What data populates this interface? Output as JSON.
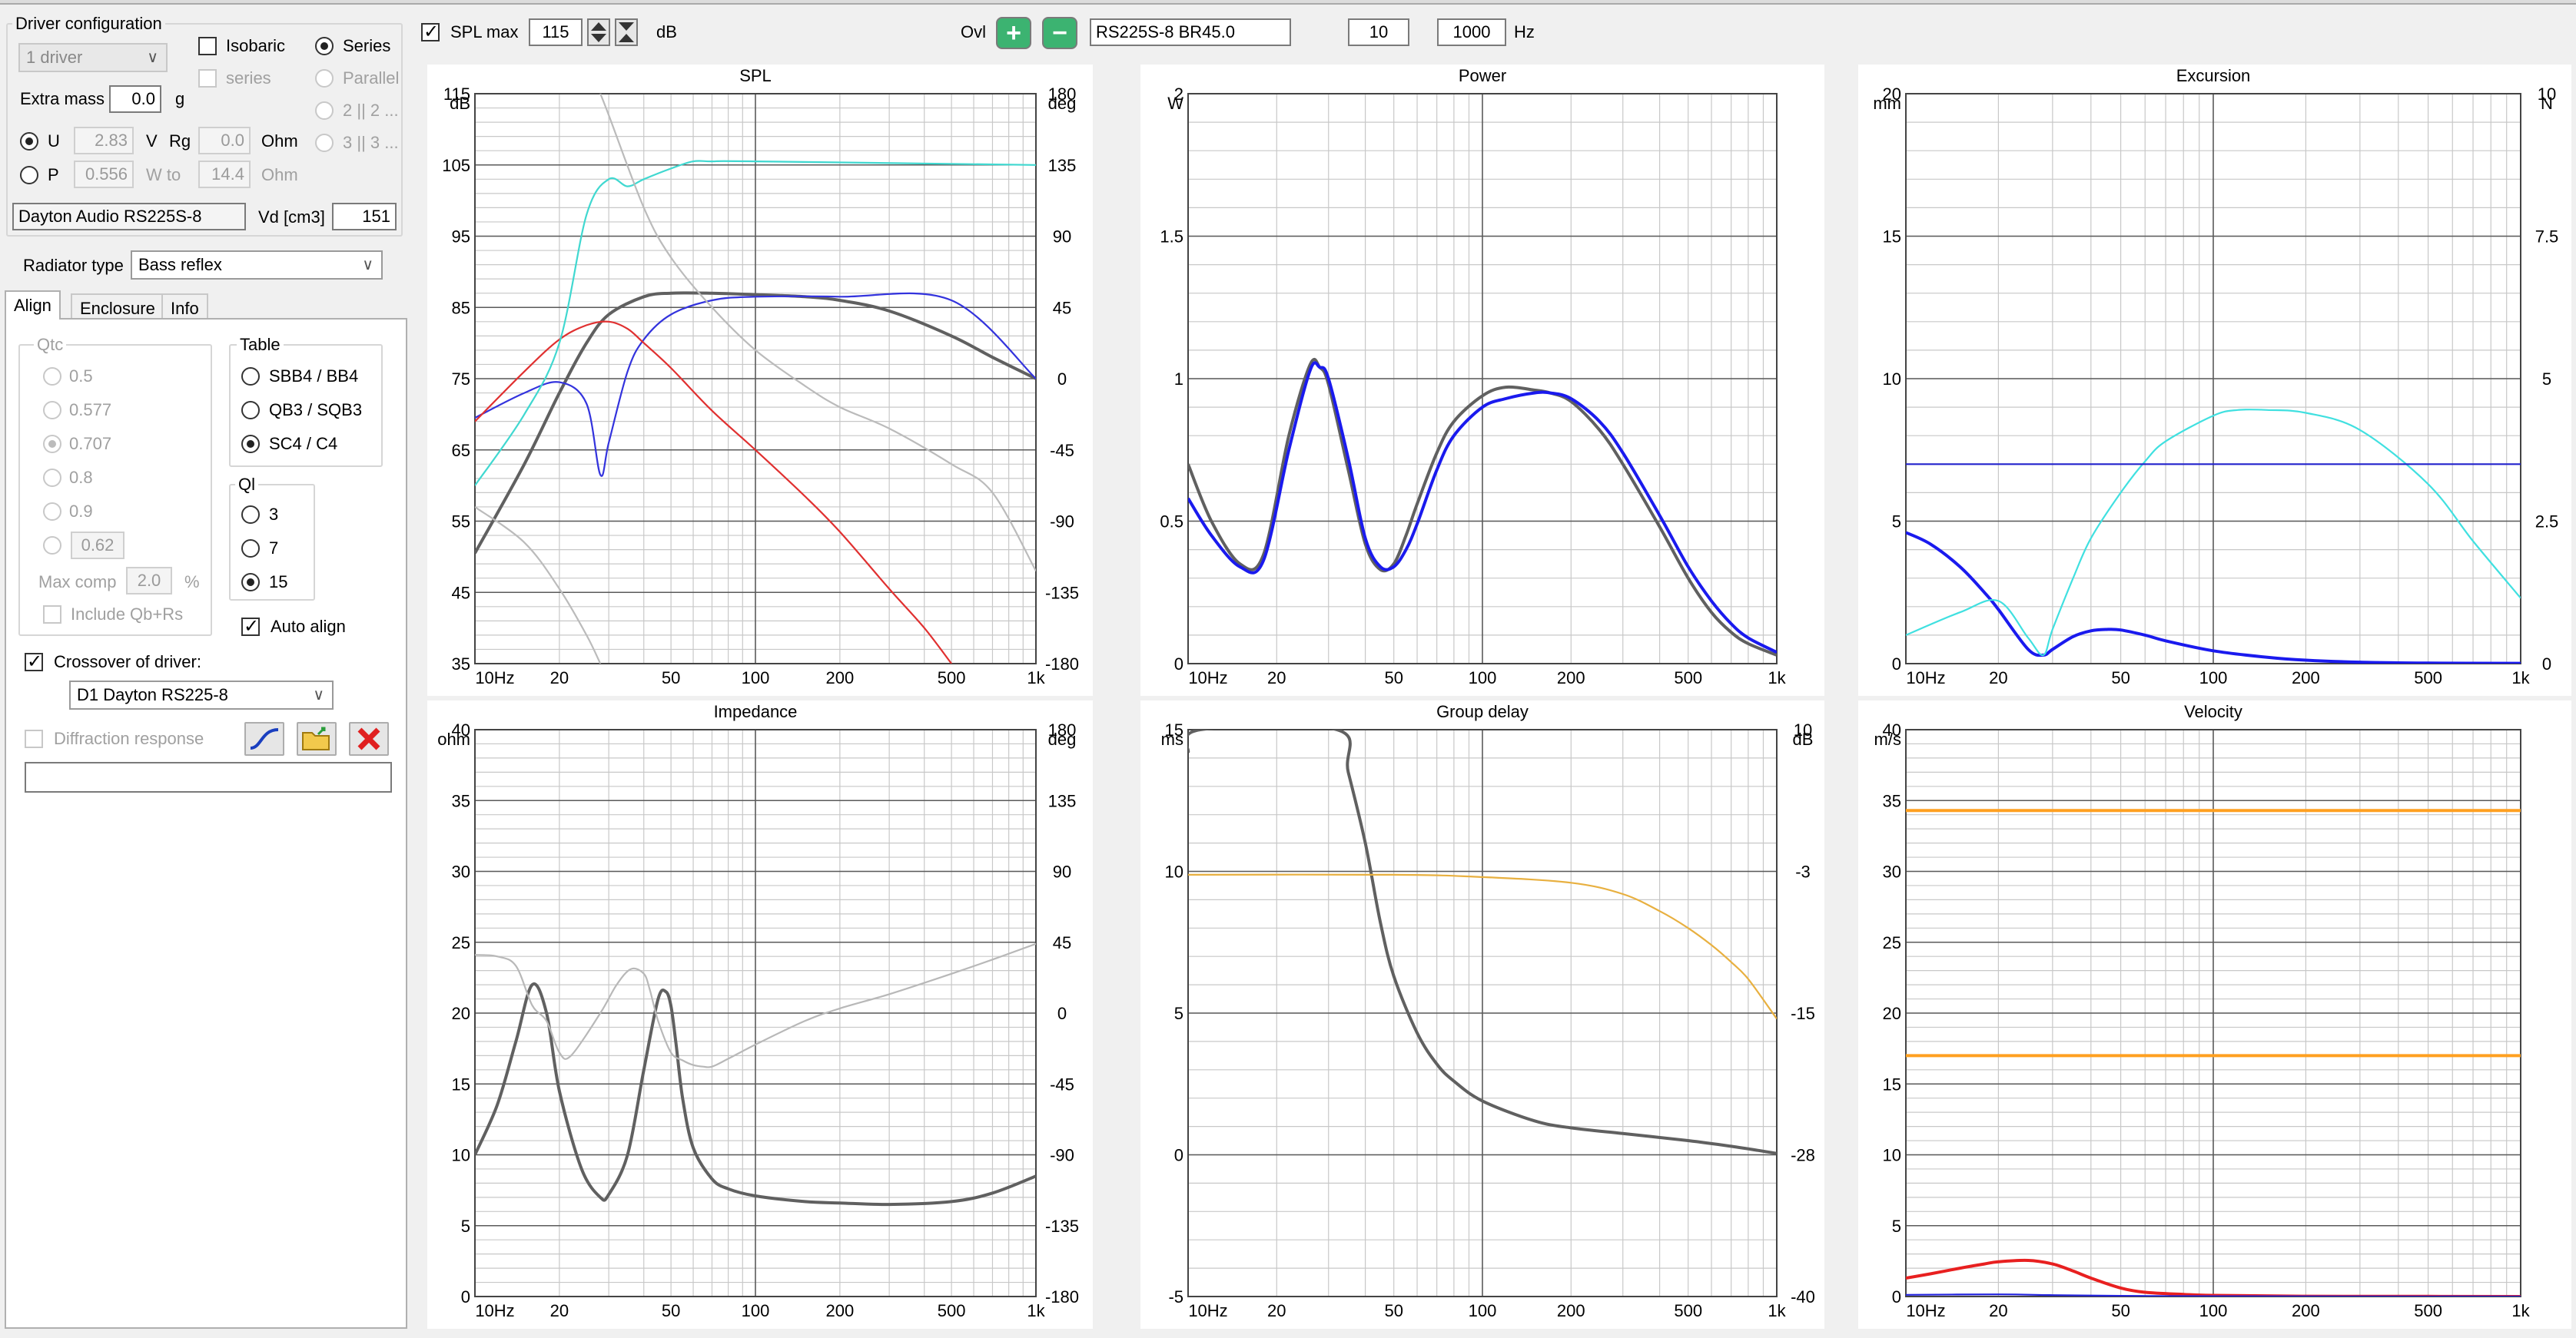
{
  "left": {
    "driver_config": {
      "title": "Driver configuration",
      "count_select": "1 driver",
      "isobaric": "Isobaric",
      "series": "Series",
      "series_sub": "series",
      "parallel": "Parallel",
      "opt_22": "2 || 2 ...",
      "opt_33": "3 || 3 ...",
      "extra_mass_label": "Extra mass",
      "extra_mass_value": "0.0",
      "extra_mass_unit": "g",
      "u_label": "U",
      "u_value": "2.83",
      "u_unit": "V",
      "rg_label": "Rg",
      "rg_value": "0.0",
      "rg_unit": "Ohm",
      "p_label": "P",
      "p_value": "0.556",
      "p_unit": "W to",
      "p_ohm_value": "14.4",
      "p_ohm_unit": "Ohm",
      "driver_name": "Dayton Audio RS225S-8",
      "vd_label": "Vd [cm3]",
      "vd_value": "151"
    },
    "radiator": {
      "label": "Radiator type",
      "value": "Bass reflex"
    },
    "tabs": [
      "Align",
      "Enclosure",
      "Info"
    ],
    "align": {
      "qtc_title": "Qtc",
      "qtc_options": [
        "0.5",
        "0.577",
        "0.707",
        "0.8",
        "0.9"
      ],
      "qtc_custom": "0.62",
      "max_comp_label": "Max comp",
      "max_comp_value": "2.0",
      "max_comp_unit": "%",
      "include_qb": "Include Qb+Rs",
      "table_title": "Table",
      "table_options": [
        "SBB4 / BB4",
        "QB3 / SQB3",
        "SC4 / C4"
      ],
      "ql_title": "Ql",
      "ql_options": [
        "3",
        "7",
        "15"
      ],
      "auto_align": "Auto align"
    },
    "crossover": {
      "label": "Crossover of driver:",
      "value": "D1 Dayton RS225-8"
    },
    "diffraction": "Diffraction response"
  },
  "toolbar": {
    "spl_max_label": "SPL max",
    "spl_max_value": "115",
    "db_unit": "dB",
    "ovl_label": "Ovl",
    "plus": "+",
    "minus": "−",
    "project_name": "RS225S-8 BR45.0",
    "freq_from": "10",
    "freq_sep": "...",
    "freq_to": "1000",
    "hz_unit": "Hz"
  },
  "charts": [
    {
      "key": "spl",
      "title": "SPL",
      "y_unit": "dB",
      "y_ticks": [
        "115",
        "105",
        "95",
        "85",
        "75",
        "65",
        "55",
        "45",
        "35"
      ],
      "y2_unit": "deg",
      "y2_ticks": [
        "180",
        "135",
        "90",
        "45",
        "0",
        "-45",
        "-90",
        "-135",
        "-180"
      ],
      "x_ticks": [
        "10Hz",
        "20",
        "50",
        "100",
        "200",
        "500",
        "1k"
      ]
    },
    {
      "key": "power",
      "title": "Power",
      "y_unit": "W",
      "y_ticks": [
        "2",
        "1.5",
        "1",
        "0.5",
        "0"
      ],
      "x_ticks": [
        "10Hz",
        "20",
        "50",
        "100",
        "200",
        "500",
        "1k"
      ]
    },
    {
      "key": "excursion",
      "title": "Excursion",
      "y_unit": "mm",
      "y_ticks": [
        "20",
        "15",
        "10",
        "5",
        "0"
      ],
      "y2_unit": "N",
      "y2_ticks": [
        "10",
        "7.5",
        "5",
        "2.5",
        "0"
      ],
      "x_ticks": [
        "10Hz",
        "20",
        "50",
        "100",
        "200",
        "500",
        "1k"
      ]
    },
    {
      "key": "impedance",
      "title": "Impedance",
      "y_unit": "ohm",
      "y_ticks": [
        "40",
        "35",
        "30",
        "25",
        "20",
        "15",
        "10",
        "5",
        "0"
      ],
      "y2_unit": "deg",
      "y2_ticks": [
        "180",
        "135",
        "90",
        "45",
        "0",
        "-45",
        "-90",
        "-135",
        "-180"
      ],
      "x_ticks": [
        "10Hz",
        "20",
        "50",
        "100",
        "200",
        "500",
        "1k"
      ]
    },
    {
      "key": "group_delay",
      "title": "Group delay",
      "y_unit": "ms",
      "y_ticks": [
        "15",
        "10",
        "5",
        "0",
        "-5"
      ],
      "y2_unit": "dB",
      "y2_ticks": [
        "10",
        "-3",
        "-15",
        "-28",
        "-40"
      ],
      "x_ticks": [
        "10Hz",
        "20",
        "50",
        "100",
        "200",
        "500",
        "1k"
      ]
    },
    {
      "key": "velocity",
      "title": "Velocity",
      "y_unit": "m/s",
      "y_ticks": [
        "40",
        "35",
        "30",
        "25",
        "20",
        "15",
        "10",
        "5",
        "0"
      ],
      "x_ticks": [
        "10Hz",
        "20",
        "50",
        "100",
        "200",
        "500",
        "1k"
      ]
    }
  ],
  "chart_data": [
    {
      "type": "line",
      "title": "SPL",
      "ylabel": "dB",
      "y2label": "deg",
      "xscale": "log",
      "xlim": [
        10,
        1000
      ],
      "ylim": [
        35,
        115
      ],
      "y2lim": [
        -180,
        180
      ],
      "series": [
        {
          "color": "#606060",
          "axis": "y",
          "x": [
            10,
            15,
            20,
            25,
            30,
            40,
            50,
            70,
            100,
            150,
            200,
            300,
            500,
            700,
            1000
          ],
          "y": [
            50.5,
            63,
            73,
            80,
            84,
            86.5,
            87,
            87,
            86.8,
            86.5,
            86,
            84.5,
            81,
            78,
            75
          ]
        },
        {
          "color": "#3333dd",
          "axis": "y",
          "x": [
            10,
            15,
            20,
            25,
            28,
            30,
            35,
            40,
            50,
            70,
            100,
            200,
            500,
            1000
          ],
          "y": [
            69.5,
            73,
            74.5,
            71.5,
            61.5,
            66,
            76,
            80.5,
            84,
            86,
            86.5,
            86.5,
            86,
            75
          ]
        },
        {
          "color": "#e03030",
          "axis": "y",
          "x": [
            10,
            15,
            20,
            25,
            30,
            35,
            40,
            50,
            70,
            100,
            150,
            200,
            300,
            400,
            500
          ],
          "y": [
            69,
            76,
            80.5,
            82.5,
            83,
            82,
            80,
            76.5,
            70.5,
            65,
            58.5,
            53.5,
            45.5,
            40,
            35
          ]
        },
        {
          "color": "#40d8d0",
          "axis": "y",
          "x": [
            10,
            15,
            20,
            25,
            30,
            35,
            40,
            50,
            60,
            70,
            100,
            1000
          ],
          "y": [
            60,
            70,
            80,
            98,
            103,
            102,
            103,
            104.5,
            105.5,
            105.5,
            105.5,
            105
          ]
        },
        {
          "color": "#bbbbbb",
          "axis": "y",
          "x": [
            10,
            15,
            20,
            25,
            28
          ],
          "y": [
            57,
            52,
            45.5,
            39,
            35
          ]
        },
        {
          "color": "#bbbbbb",
          "axis": "y",
          "x": [
            28,
            30,
            40,
            50,
            70,
            100,
            150,
            200,
            300,
            500,
            700,
            1000
          ],
          "y": [
            115,
            112,
            99,
            92,
            85,
            79,
            74,
            71,
            68,
            63,
            59,
            48
          ]
        }
      ]
    },
    {
      "type": "line",
      "title": "Power",
      "ylabel": "W",
      "xscale": "log",
      "xlim": [
        10,
        1000
      ],
      "ylim": [
        0,
        2
      ],
      "series": [
        {
          "color": "#606060",
          "x": [
            10,
            12,
            15,
            18,
            22,
            26,
            28,
            30,
            35,
            40,
            45,
            50,
            55,
            60,
            70,
            80,
            100,
            120,
            150,
            170,
            200,
            250,
            300,
            400,
            500,
            600,
            700,
            800,
            1000
          ],
          "y": [
            0.7,
            0.5,
            0.35,
            0.38,
            0.8,
            1.05,
            1.04,
            0.98,
            0.68,
            0.42,
            0.33,
            0.35,
            0.45,
            0.56,
            0.74,
            0.85,
            0.94,
            0.97,
            0.96,
            0.95,
            0.92,
            0.82,
            0.7,
            0.48,
            0.3,
            0.18,
            0.11,
            0.07,
            0.03
          ]
        },
        {
          "color": "#1a1aee",
          "x": [
            10,
            12,
            15,
            18,
            22,
            26,
            28,
            30,
            35,
            40,
            45,
            50,
            55,
            60,
            70,
            80,
            100,
            120,
            150,
            170,
            200,
            250,
            300,
            400,
            500,
            600,
            700,
            800,
            1000
          ],
          "y": [
            0.58,
            0.45,
            0.34,
            0.36,
            0.75,
            1.03,
            1.04,
            1.0,
            0.72,
            0.44,
            0.34,
            0.34,
            0.4,
            0.49,
            0.68,
            0.8,
            0.9,
            0.93,
            0.95,
            0.95,
            0.93,
            0.85,
            0.74,
            0.52,
            0.34,
            0.22,
            0.14,
            0.09,
            0.04
          ]
        }
      ]
    },
    {
      "type": "line",
      "title": "Excursion",
      "ylabel": "mm",
      "y2label": "N",
      "xscale": "log",
      "xlim": [
        10,
        1000
      ],
      "ylim": [
        0,
        20
      ],
      "y2lim": [
        0,
        10
      ],
      "series": [
        {
          "color": "#1a1aee",
          "x": [
            10,
            12,
            15,
            18,
            20,
            25,
            28,
            30,
            35,
            40,
            45,
            50,
            60,
            70,
            100,
            150,
            200,
            300,
            500,
            1000
          ],
          "y": [
            4.6,
            4.2,
            3.4,
            2.5,
            1.9,
            0.5,
            0.3,
            0.5,
            0.95,
            1.15,
            1.2,
            1.18,
            1.0,
            0.8,
            0.45,
            0.22,
            0.12,
            0.05,
            0.02,
            0.01
          ]
        },
        {
          "color": "#40e0e0",
          "x": [
            10,
            15,
            20,
            25,
            28,
            30,
            35,
            40,
            50,
            60,
            70,
            100,
            120,
            150,
            200,
            300,
            500,
            700,
            1000
          ],
          "y": [
            1.0,
            1.8,
            2.2,
            0.9,
            0.3,
            1.2,
            3.0,
            4.4,
            6.0,
            7.1,
            7.8,
            8.7,
            8.9,
            8.9,
            8.8,
            8.2,
            6.3,
            4.3,
            2.3
          ]
        },
        {
          "color": "#2222cc",
          "x": [
            10,
            1000
          ],
          "y": [
            7.0,
            7.0
          ]
        }
      ]
    },
    {
      "type": "line",
      "title": "Impedance",
      "ylabel": "ohm",
      "y2label": "deg",
      "xscale": "log",
      "xlim": [
        10,
        1000
      ],
      "ylim": [
        0,
        40
      ],
      "y2lim": [
        -180,
        180
      ],
      "series": [
        {
          "color": "#606060",
          "axis": "y",
          "x": [
            10,
            12,
            14,
            16,
            18,
            20,
            24,
            28,
            30,
            35,
            40,
            45,
            48,
            50,
            52,
            55,
            60,
            70,
            80,
            100,
            150,
            200,
            300,
            500,
            700,
            1000
          ],
          "y": [
            10,
            13.5,
            18,
            22,
            20,
            14.5,
            9,
            7,
            7.2,
            10,
            16,
            21,
            21.5,
            20.5,
            18,
            14,
            10.5,
            8.3,
            7.6,
            7.1,
            6.7,
            6.6,
            6.5,
            6.7,
            7.3,
            8.5
          ]
        },
        {
          "color": "#b8b8b8",
          "axis": "y2",
          "x": [
            10,
            12,
            14,
            16,
            18,
            20,
            22,
            28,
            32,
            36,
            40,
            42,
            45,
            50,
            55,
            60,
            65,
            70,
            80,
            100,
            150,
            200,
            300,
            500,
            700,
            1000
          ],
          "y": [
            37,
            36,
            30,
            5,
            -5,
            -25,
            -27,
            0,
            18,
            28,
            25,
            15,
            -5,
            -25,
            -30,
            -33,
            -34,
            -34,
            -29,
            -20,
            -5,
            3,
            12,
            25,
            34,
            44
          ]
        }
      ]
    },
    {
      "type": "line",
      "title": "Group delay",
      "ylabel": "ms",
      "y2label": "dB",
      "xscale": "log",
      "xlim": [
        10,
        1000
      ],
      "ylim": [
        -5,
        15
      ],
      "y2lim": [
        -40,
        10
      ],
      "series": [
        {
          "color": "#606060",
          "axis": "y",
          "x": [
            10,
            11,
            32,
            35,
            40,
            45,
            50,
            60,
            70,
            80,
            100,
            150,
            200,
            300,
            500,
            700,
            1000
          ],
          "y": [
            14.2,
            15,
            15,
            13.5,
            11,
            8.2,
            6.3,
            4.3,
            3.2,
            2.6,
            1.9,
            1.2,
            0.95,
            0.75,
            0.5,
            0.3,
            0.05
          ]
        },
        {
          "color": "#e8b040",
          "axis": "y2",
          "x": [
            10,
            50,
            100,
            200,
            300,
            400,
            500,
            600,
            700,
            800,
            1000
          ],
          "y": [
            -2.8,
            -2.8,
            -3,
            -3.5,
            -4.5,
            -6,
            -7.5,
            -9,
            -10.5,
            -12,
            -15.5
          ]
        }
      ]
    },
    {
      "type": "line",
      "title": "Velocity",
      "ylabel": "m/s",
      "xscale": "log",
      "xlim": [
        10,
        1000
      ],
      "ylim": [
        0,
        40
      ],
      "series": [
        {
          "color": "#ffa020",
          "x": [
            10,
            1000
          ],
          "y": [
            34.3,
            34.3
          ]
        },
        {
          "color": "#ffa020",
          "x": [
            10,
            1000
          ],
          "y": [
            17,
            17
          ]
        },
        {
          "color": "#e82020",
          "x": [
            10,
            12,
            15,
            18,
            20,
            25,
            30,
            35,
            40,
            50,
            60,
            80,
            100,
            200,
            500,
            1000
          ],
          "y": [
            1.3,
            1.6,
            2.0,
            2.3,
            2.45,
            2.55,
            2.3,
            1.8,
            1.3,
            0.6,
            0.3,
            0.15,
            0.08,
            0.02,
            0.01,
            0
          ]
        },
        {
          "color": "#2222dd",
          "x": [
            10,
            20,
            30,
            50,
            100,
            1000
          ],
          "y": [
            0.12,
            0.15,
            0.1,
            0.05,
            0.02,
            0
          ]
        }
      ]
    }
  ]
}
